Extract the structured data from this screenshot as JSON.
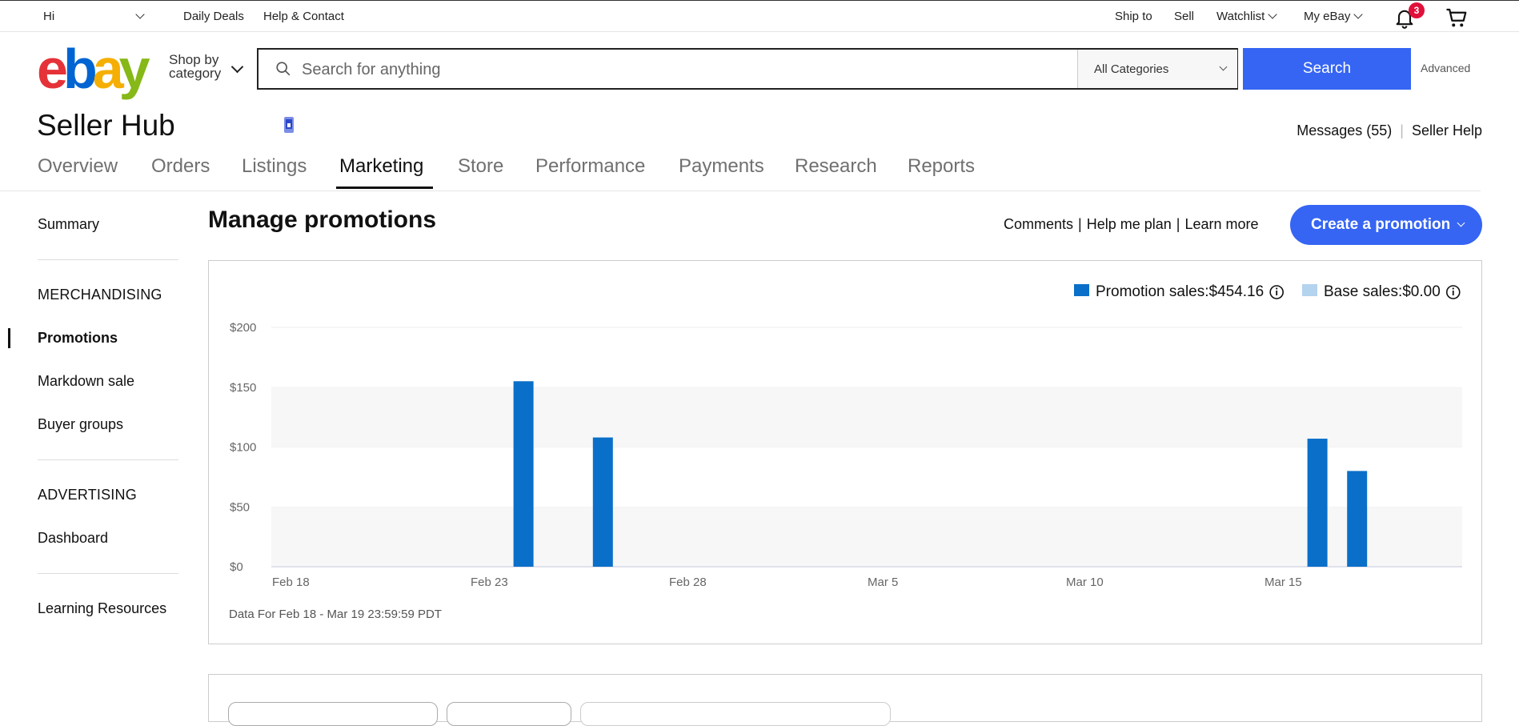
{
  "topbar": {
    "greeting": "Hi",
    "daily_deals": "Daily Deals",
    "help_contact": "Help & Contact",
    "ship_to": "Ship to",
    "sell": "Sell",
    "watchlist": "Watchlist",
    "my_ebay": "My eBay",
    "notification_count": "3"
  },
  "header": {
    "logo_letters": [
      "e",
      "b",
      "a",
      "y"
    ],
    "logo_colors": [
      "#e53238",
      "#0064d2",
      "#f5af02",
      "#86b817"
    ],
    "shop_by_line1": "Shop by",
    "shop_by_line2": "category",
    "search_placeholder": "Search for anything",
    "category": "All Categories",
    "search_button": "Search",
    "advanced": "Advanced"
  },
  "hub": {
    "title": "Seller Hub",
    "messages": "Messages (55)",
    "seller_help": "Seller Help",
    "tabs": [
      {
        "label": "Overview"
      },
      {
        "label": "Orders"
      },
      {
        "label": "Listings"
      },
      {
        "label": "Marketing",
        "active": true
      },
      {
        "label": "Store"
      },
      {
        "label": "Performance"
      },
      {
        "label": "Payments"
      },
      {
        "label": "Research"
      },
      {
        "label": "Reports"
      }
    ]
  },
  "sidebar": {
    "summary": "Summary",
    "merchandising_header": "MERCHANDISING",
    "promotions": "Promotions",
    "markdown_sale": "Markdown sale",
    "buyer_groups": "Buyer groups",
    "advertising_header": "ADVERTISING",
    "dashboard": "Dashboard",
    "learning_resources": "Learning Resources"
  },
  "main": {
    "title": "Manage promotions",
    "comments": "Comments",
    "help_me_plan": "Help me plan",
    "learn_more": "Learn more",
    "create_promotion": "Create a promotion",
    "footnote": "Data For Feb 18 - Mar 19 23:59:59 PDT"
  },
  "colors": {
    "accent": "#3665f3",
    "promotion_bar": "#0a6fc8",
    "base_bar": "#b3d3ee"
  },
  "chart_data": {
    "type": "bar",
    "legend_placement": "top-right",
    "series": [
      {
        "name": "Promotion sales:$454.16",
        "color": "#0a6fc8"
      },
      {
        "name": "Base sales:$0.00",
        "color": "#b3d3ee"
      }
    ],
    "x_start_label": "Feb 18",
    "x_ticks": [
      "Feb 18",
      "Feb 23",
      "Feb 28",
      "Mar 5",
      "Mar 10",
      "Mar 15"
    ],
    "bars": [
      {
        "date": "Feb 24",
        "value": 155
      },
      {
        "date": "Feb 26",
        "value": 108
      },
      {
        "date": "Mar 16",
        "value": 107
      },
      {
        "date": "Mar 17",
        "value": 80
      }
    ],
    "y_ticks": [
      "$0",
      "$50",
      "$100",
      "$150",
      "$200"
    ],
    "ylim": [
      0,
      200
    ],
    "grid": "alternating bands"
  }
}
